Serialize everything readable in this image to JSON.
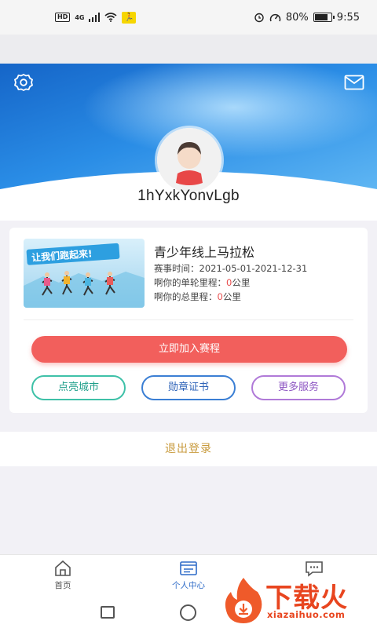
{
  "status_bar": {
    "hd_badge": "HD",
    "network": "4G",
    "battery_text": "80%",
    "battery_level": 0.8,
    "time": "9:55"
  },
  "profile": {
    "username": "1hYxkYonvLgb",
    "settings_icon": "gear-icon",
    "mail_icon": "mail-icon"
  },
  "event_card": {
    "image_text": "让我们跑起来!",
    "title": "青少年线上马拉松",
    "date_label": "赛事时间：",
    "date_range": "2021-05-01-2021-12-31",
    "single_label": "啊你的单轮里程：",
    "single_value": "0",
    "single_unit": "公里",
    "total_label": "啊你的总里程：",
    "total_value": "0",
    "total_unit": "公里",
    "join_button": "立即加入赛程",
    "actions": [
      "点亮城市",
      "勋章证书",
      "更多服务"
    ]
  },
  "logout_label": "退出登录",
  "tabs": [
    {
      "label": "首页",
      "icon": "home-icon",
      "active": false
    },
    {
      "label": "个人中心",
      "icon": "profile-card-icon",
      "active": true
    },
    {
      "label": "",
      "icon": "chat-icon",
      "active": false
    }
  ],
  "watermark": {
    "text": "下载火",
    "url": "xiazaihuo.com"
  },
  "colors": {
    "accent_red": "#f25f5c",
    "active_tab": "#2f6cc8",
    "logout_gold": "#c89a3c",
    "header_blue": "#1e7fd8"
  }
}
